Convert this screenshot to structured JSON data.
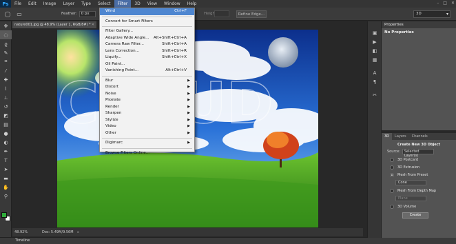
{
  "menubar": {
    "logo": "Ps",
    "items": [
      "File",
      "Edit",
      "Image",
      "Layer",
      "Type",
      "Select",
      "Filter",
      "3D",
      "View",
      "Window",
      "Help"
    ],
    "active": "Filter",
    "window_controls": [
      "–",
      "□",
      "✕"
    ]
  },
  "options": {
    "feather_label": "Feather:",
    "feather_value": "0 px",
    "height_label": "Height:",
    "refine_edge": "Refine Edge...",
    "workspace_select": "3D"
  },
  "document": {
    "tab_title": "nature001.jpg @ 48.9% (Layer 1, RGB/8#) *",
    "zoom": "48.92%",
    "doc_info": "Doc: 5.49M/9.56M",
    "watermark": "CLOUD"
  },
  "timeline": {
    "label": "Timeline"
  },
  "properties": {
    "tab": "Properties",
    "title": "No Properties"
  },
  "panel3d": {
    "tabs": [
      "3D",
      "Layers",
      "Channels"
    ],
    "active_tab": "3D",
    "title": "Create New 3D Object",
    "source_label": "Source:",
    "source_value": "Selected Layer(s)",
    "options": [
      {
        "label": "3D Postcard",
        "selected": false
      },
      {
        "label": "3D Extrusion",
        "selected": false
      },
      {
        "label": "Mesh From Preset",
        "selected": true
      },
      {
        "label": "Mesh From Depth Map",
        "selected": false
      },
      {
        "label": "3D Volume",
        "selected": false
      }
    ],
    "preset_value": "Cone",
    "depth_value": "Plane",
    "create_button": "Create"
  },
  "filter_menu": {
    "items": [
      {
        "label": "Wind",
        "shortcut": "Ctrl+F",
        "highlighted": true
      },
      {
        "separator": true
      },
      {
        "label": "Convert for Smart Filters"
      },
      {
        "separator": true
      },
      {
        "label": "Filter Gallery..."
      },
      {
        "label": "Adaptive Wide Angle...",
        "shortcut": "Alt+Shift+Ctrl+A"
      },
      {
        "label": "Camera Raw Filter...",
        "shortcut": "Shift+Ctrl+A"
      },
      {
        "label": "Lens Correction...",
        "shortcut": "Shift+Ctrl+R"
      },
      {
        "label": "Liquify...",
        "shortcut": "Shift+Ctrl+X"
      },
      {
        "label": "Oil Paint..."
      },
      {
        "label": "Vanishing Point...",
        "shortcut": "Alt+Ctrl+V"
      },
      {
        "separator": true
      },
      {
        "label": "Blur",
        "submenu": true
      },
      {
        "label": "Distort",
        "submenu": true
      },
      {
        "label": "Noise",
        "submenu": true
      },
      {
        "label": "Pixelate",
        "submenu": true
      },
      {
        "label": "Render",
        "submenu": true
      },
      {
        "label": "Sharpen",
        "submenu": true
      },
      {
        "label": "Stylize",
        "submenu": true
      },
      {
        "label": "Video",
        "submenu": true
      },
      {
        "label": "Other",
        "submenu": true
      },
      {
        "separator": true
      },
      {
        "label": "Digimarc",
        "submenu": true
      },
      {
        "separator": true
      },
      {
        "label": "Browse Filters Online..."
      }
    ]
  },
  "tools": [
    "move-tool",
    "marquee-tool",
    "lasso-tool",
    "quick-select-tool",
    "crop-tool",
    "eyedropper-tool",
    "healing-brush-tool",
    "brush-tool",
    "clone-stamp-tool",
    "history-brush-tool",
    "eraser-tool",
    "gradient-tool",
    "blur-tool",
    "dodge-tool",
    "pen-tool",
    "type-tool",
    "path-select-tool",
    "shape-tool",
    "hand-tool",
    "zoom-tool"
  ],
  "panel_icons": [
    "history-icon",
    "actions-icon",
    "adjustments-icon",
    "styles-icon",
    "swatches-icon",
    "character-icon",
    "paragraph-icon",
    "tool-presets-icon"
  ],
  "colors": {
    "foreground": "#2faa3a",
    "background": "#ffffff",
    "highlight": "#4e86d0"
  }
}
